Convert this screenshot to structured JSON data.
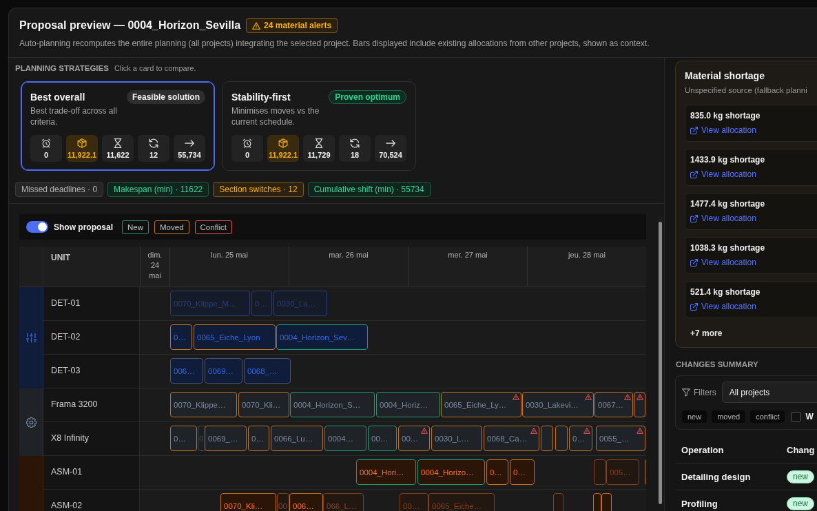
{
  "header": {
    "title": "Proposal preview — 0004_Horizon_Sevilla",
    "alert": "24 material alerts",
    "subtitle": "Auto-planning recomputes the entire planning (all projects) integrating the selected project. Bars displayed include existing allocations from other projects, shown as context."
  },
  "strategies": {
    "heading": "PLANNING STRATEGIES",
    "hint": "Click a card to compare.",
    "cards": [
      {
        "title": "Best overall",
        "badge": {
          "label": "Feasible solution",
          "kind": "feasible"
        },
        "description": "Best trade-off across all criteria.",
        "selected": true,
        "metrics": [
          {
            "value": "0",
            "flagged": false
          },
          {
            "value": "11,922.1",
            "flagged": true
          },
          {
            "value": "11,622",
            "flagged": false
          },
          {
            "value": "12",
            "flagged": false
          },
          {
            "value": "55,734",
            "flagged": false
          }
        ]
      },
      {
        "title": "Stability-first",
        "badge": {
          "label": "Proven optimum",
          "kind": "optimal"
        },
        "description": "Minimises moves vs the current schedule.",
        "selected": false,
        "metrics": [
          {
            "value": "0",
            "flagged": false
          },
          {
            "value": "11,922.1",
            "flagged": true
          },
          {
            "value": "11,729",
            "flagged": false
          },
          {
            "value": "18",
            "flagged": false
          },
          {
            "value": "70,524",
            "flagged": false
          }
        ]
      }
    ]
  },
  "kpis": [
    {
      "label": "Missed deadlines · 0",
      "kind": "neutral"
    },
    {
      "label": "Makespan (min) · 11622",
      "kind": "good"
    },
    {
      "label": "Section switches · 12",
      "kind": "warn"
    },
    {
      "label": "Cumulative shift (min) · 55734",
      "kind": "good"
    }
  ],
  "gantt": {
    "toggle": {
      "label": "Show proposal",
      "on": true
    },
    "legend": [
      {
        "label": "New",
        "kind": "new"
      },
      {
        "label": "Moved",
        "kind": "moved"
      },
      {
        "label": "Conflict",
        "kind": "conflict"
      }
    ],
    "unit_heading": "UNIT",
    "days": [
      "dim. 24 mai",
      "lun. 25 mai",
      "mar. 26 mai",
      "mer. 27 mai",
      "jeu. 28 mai"
    ],
    "groups": [
      {
        "color": "#0f1c3a",
        "units": [
          {
            "name": "DET-01",
            "bars": [
              {
                "label": "0070_Klippe_M…",
                "kind": "context",
                "conflict": false
              },
              {
                "label": "0…",
                "kind": "context",
                "conflict": false
              },
              {
                "label": "0030_La…",
                "kind": "context",
                "conflict": false
              }
            ]
          },
          {
            "name": "DET-02",
            "bars": [
              {
                "label": "0…",
                "kind": "moved",
                "conflict": false
              },
              {
                "label": "0065_Eiche_Lyon",
                "kind": "moved",
                "conflict": false
              },
              {
                "label": "0004_Horizon_Sev…",
                "kind": "new",
                "conflict": false
              }
            ]
          },
          {
            "name": "DET-03",
            "bars": [
              {
                "label": "006…",
                "kind": "unchanged",
                "conflict": false
              },
              {
                "label": "0069…",
                "kind": "unchanged",
                "conflict": false
              },
              {
                "label": "0068_…",
                "kind": "unchanged",
                "conflict": false
              }
            ]
          }
        ]
      },
      {
        "color": "#1f2328",
        "units": [
          {
            "name": "Frama 3200",
            "bars": [
              {
                "label": "0070_Klippe…",
                "kind": "moved",
                "conflict": false
              },
              {
                "label": "0070_Kli…",
                "kind": "moved",
                "conflict": false
              },
              {
                "label": "0004_Horizon_S…",
                "kind": "new",
                "conflict": false
              },
              {
                "label": "0004_Horiz…",
                "kind": "new",
                "conflict": false
              },
              {
                "label": "0065_Eiche_Ly…",
                "kind": "moved",
                "conflict": true
              },
              {
                "label": "0030_Lakevi…",
                "kind": "moved",
                "conflict": true
              },
              {
                "label": "0067…",
                "kind": "moved",
                "conflict": true
              },
              {
                "kind": "moved",
                "conflict": true
              }
            ]
          },
          {
            "name": "X8 Infinity",
            "bars": [
              {
                "label": "0…",
                "kind": "moved",
                "conflict": false
              },
              {
                "label": "0",
                "kind": "context",
                "conflict": false
              },
              {
                "label": "0069_…",
                "kind": "moved",
                "conflict": false
              },
              {
                "label": "0…",
                "kind": "moved",
                "conflict": false
              },
              {
                "label": "0066_Lu…",
                "kind": "moved",
                "conflict": false
              },
              {
                "label": "0004…",
                "kind": "new",
                "conflict": false
              },
              {
                "label": "00…",
                "kind": "new",
                "conflict": false
              },
              {
                "label": "00…",
                "kind": "moved",
                "conflict": true
              },
              {
                "label": "0030_L…",
                "kind": "moved",
                "conflict": false
              },
              {
                "label": "0068_Ca…",
                "kind": "moved",
                "conflict": true
              },
              {
                "kind": "moved",
                "conflict": false
              },
              {
                "kind": "moved",
                "conflict": false
              },
              {
                "label": "0…",
                "kind": "moved",
                "conflict": true
              },
              {
                "label": "0055_…",
                "kind": "moved",
                "conflict": true
              }
            ]
          }
        ]
      },
      {
        "color": "#2b1507",
        "units": [
          {
            "name": "ASM-01",
            "bars": [
              {
                "label": "0004_Hori…",
                "kind": "new",
                "conflict": false
              },
              {
                "label": "0004_Horizo…",
                "kind": "new",
                "conflict": false
              },
              {
                "label": "0…",
                "kind": "moved",
                "conflict": false
              },
              {
                "label": "0…",
                "kind": "moved",
                "conflict": false
              },
              {
                "kind": "context",
                "conflict": false
              },
              {
                "label": "005…",
                "kind": "context",
                "conflict": false
              },
              {
                "kind": "moved",
                "conflict": false
              }
            ]
          },
          {
            "name": "ASM-02",
            "bars": [
              {
                "label": "0070_Kli…",
                "kind": "moved",
                "conflict": false
              },
              {
                "label": "00",
                "kind": "context",
                "conflict": false
              },
              {
                "label": "006…",
                "kind": "moved",
                "conflict": false
              },
              {
                "label": "066_L…",
                "kind": "context",
                "conflict": false
              },
              {
                "label": "00…",
                "kind": "context",
                "conflict": false
              },
              {
                "label": "0065_Eiche…",
                "kind": "context",
                "conflict": false
              },
              {
                "kind": "context",
                "conflict": false
              },
              {
                "kind": "moved",
                "conflict": false
              },
              {
                "kind": "moved",
                "conflict": false
              }
            ]
          }
        ]
      }
    ]
  },
  "shortage": {
    "title": "Material shortage",
    "subtitle": "Unspecified source (fallback planni",
    "items": [
      {
        "amount": "835.0 kg shortage",
        "link": "View allocation"
      },
      {
        "amount": "1433.9 kg shortage",
        "link": "View allocation"
      },
      {
        "amount": "1477.4 kg shortage",
        "link": "View allocation"
      },
      {
        "amount": "1038.3 kg shortage",
        "link": "View allocation"
      },
      {
        "amount": "521.4 kg shortage",
        "link": "View allocation"
      }
    ],
    "more": "+7 more"
  },
  "changes": {
    "heading": "CHANGES SUMMARY",
    "filters_label": "Filters",
    "project_select": "All projects",
    "chips": [
      {
        "label": "new",
        "selected": false
      },
      {
        "label": "moved",
        "selected": false
      },
      {
        "label": "conflict",
        "selected": false
      }
    ],
    "checkbox": {
      "label": "W",
      "checked": false
    },
    "columns": [
      "Operation",
      "Chang"
    ],
    "rows": [
      {
        "operation": "Detailing design",
        "change": {
          "label": "new",
          "kind": "new"
        }
      },
      {
        "operation": "Profiling",
        "change": {
          "label": "new",
          "kind": "new"
        }
      }
    ]
  }
}
